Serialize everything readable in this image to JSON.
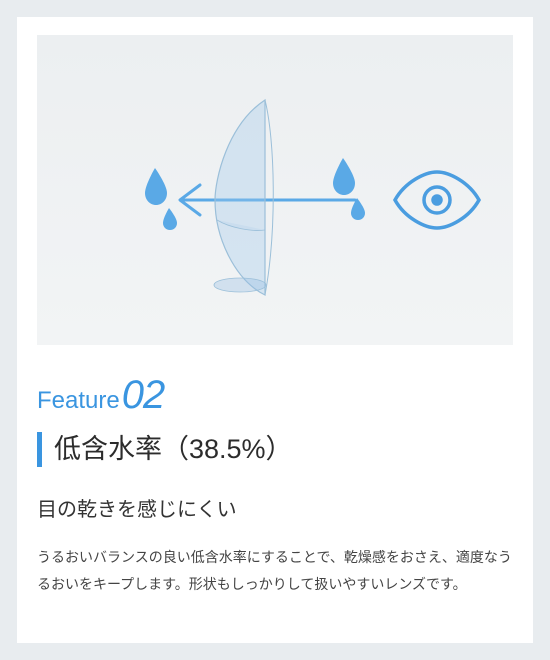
{
  "feature": {
    "label_prefix": "Feature",
    "number": "02",
    "title": "低含水率（38.5%）",
    "subtitle": "目の乾きを感じにくい",
    "body": "うるおいバランスの良い低含水率にすることで、乾燥感をおさえ、適度なうるおいをキープします。形状もしっかりして扱いやすいレンズです。",
    "accent_color": "#3a95e0",
    "icons": {
      "lens": "contact-lens",
      "drops": "water-drop",
      "eye": "eye",
      "arrow": "arrow-left"
    }
  }
}
